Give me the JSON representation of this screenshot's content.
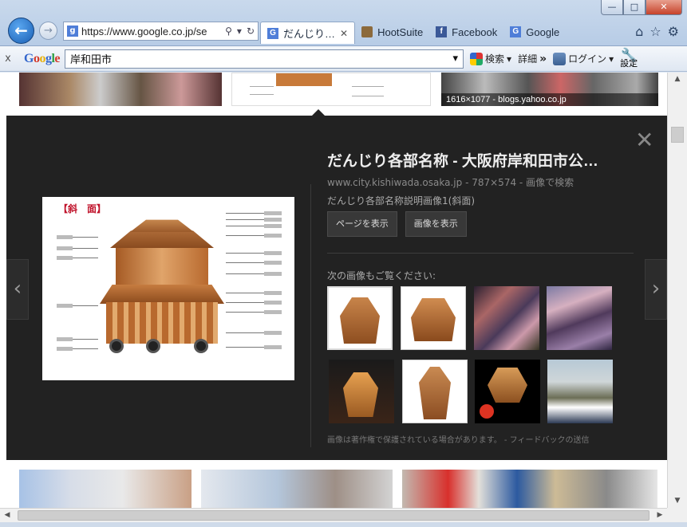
{
  "window": {
    "controls": {
      "minimize": "—",
      "maximize": "□",
      "close": "✕"
    }
  },
  "addressbar": {
    "url": "https://www.google.co.jp/se",
    "search_icon": "search-icon",
    "dropdown_icon": "chevron-down-icon",
    "refresh_icon": "refresh-icon"
  },
  "tabs": [
    {
      "label": "だんじり…",
      "active": true,
      "favicon": "G"
    },
    {
      "label": "HootSuite",
      "active": false
    },
    {
      "label": "Facebook",
      "active": false,
      "favicon": "f"
    },
    {
      "label": "Google",
      "active": false,
      "favicon": "G"
    }
  ],
  "toolbar": {
    "google_logo": [
      "G",
      "o",
      "o",
      "g",
      "l",
      "e"
    ],
    "search_query": "岸和田市",
    "search_label": "検索",
    "more_label": "詳細",
    "more_chevrons": "»",
    "login_label": "ログイン",
    "settings_label": "設定",
    "close_x": "x"
  },
  "top_thumbs": {
    "caption": "1616×1077 - blogs.yahoo.co.jp"
  },
  "detail": {
    "title": "だんじり各部名称 - 大阪府岸和田市公…",
    "domain": "www.city.kishiwada.osaka.jp",
    "size": "787×574",
    "similar_link": "画像で検索",
    "description": "だんじり各部名称説明画像1(斜面)",
    "preview_title": "【斜　面】",
    "view_page_label": "ページを表示",
    "view_image_label": "画像を表示",
    "more_images_label": "次の画像もご覧ください:",
    "copyright_notice": "画像は著作権で保護されている場合があります。 - フィードバックの送信",
    "close_symbol": "✕",
    "prev_symbol": "‹",
    "next_symbol": "›"
  },
  "colors": {
    "panel_bg": "#222222",
    "window_accent": "#1a5fb4",
    "close_btn": "#c6422a"
  }
}
